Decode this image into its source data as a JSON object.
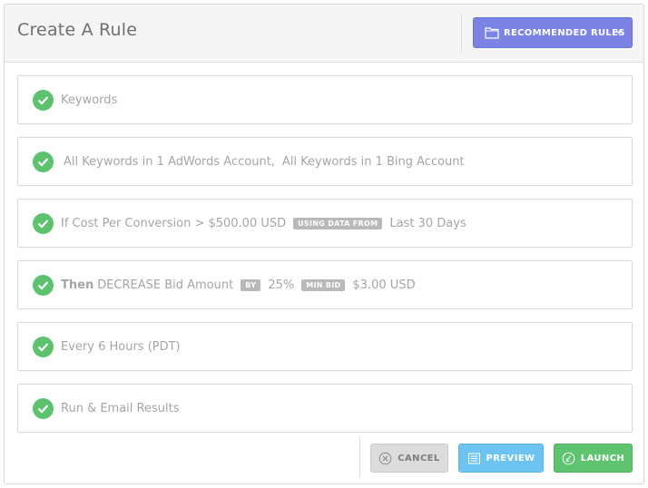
{
  "header": {
    "title": "Create A Rule",
    "recommended_label": "RECOMMENDED RULES",
    "recommended_icon": "folder-icon",
    "dropdown_icon": "chevron-down-icon"
  },
  "rules": {
    "keywords": "Keywords",
    "accounts": {
      "adwords": "All Keywords in 1 AdWords Account,",
      "bing": "All Keywords in 1 Bing Account"
    },
    "condition": {
      "text": "If Cost Per Conversion > $500.00 USD",
      "tag": "USING DATA FROM",
      "range": "Last 30 Days"
    },
    "action": {
      "then": "Then",
      "text": "DECREASE Bid Amount",
      "by_tag": "BY",
      "percent": "25%",
      "min_tag": "MIN BID",
      "min_value": "$3.00 USD"
    },
    "schedule": "Every 6 Hours (PDT)",
    "results": "Run & Email Results"
  },
  "footer": {
    "cancel_label": "CANCEL",
    "preview_label": "PREVIEW",
    "launch_label": "LAUNCH"
  },
  "colors": {
    "accent": "#7b83e4",
    "check": "#5cc26e",
    "preview": "#6dc4f2",
    "launch": "#5fc46f"
  }
}
